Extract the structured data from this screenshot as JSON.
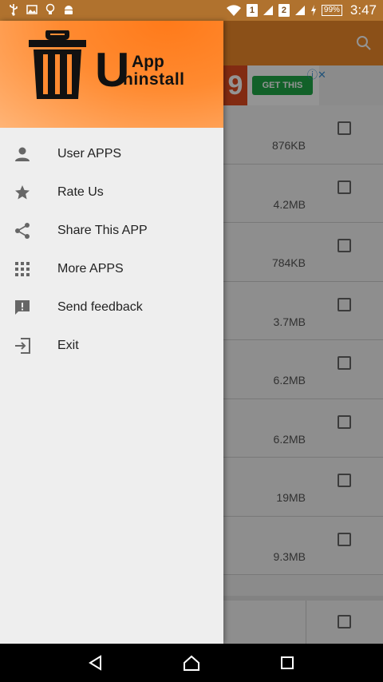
{
  "status_bar": {
    "sim1": "1",
    "sim2": "2",
    "battery": "99%",
    "time": "3:47"
  },
  "background": {
    "ad": {
      "number": "9",
      "button": "GET THIS NOW",
      "close": "ⓘ✕"
    },
    "rows": [
      {
        "size": "876KB"
      },
      {
        "size": "4.2MB"
      },
      {
        "size": "784KB"
      },
      {
        "size": "3.7MB"
      },
      {
        "size": "6.2MB"
      },
      {
        "size": "6.2MB"
      },
      {
        "size": "19MB"
      },
      {
        "size": "9.3MB"
      }
    ]
  },
  "drawer": {
    "logo": {
      "u": "U",
      "app": "App",
      "ninstall": "ninstall"
    },
    "menu": [
      {
        "label": "User APPS",
        "icon": "person-icon"
      },
      {
        "label": "Rate Us",
        "icon": "star-icon"
      },
      {
        "label": "Share This APP",
        "icon": "share-icon"
      },
      {
        "label": "More APPS",
        "icon": "grid-icon"
      },
      {
        "label": "Send feedback",
        "icon": "feedback-icon"
      },
      {
        "label": "Exit",
        "icon": "exit-icon"
      }
    ]
  },
  "colors": {
    "accent": "#f08a2a",
    "drawer_bg": "#eeeeee",
    "icon": "#666666"
  }
}
